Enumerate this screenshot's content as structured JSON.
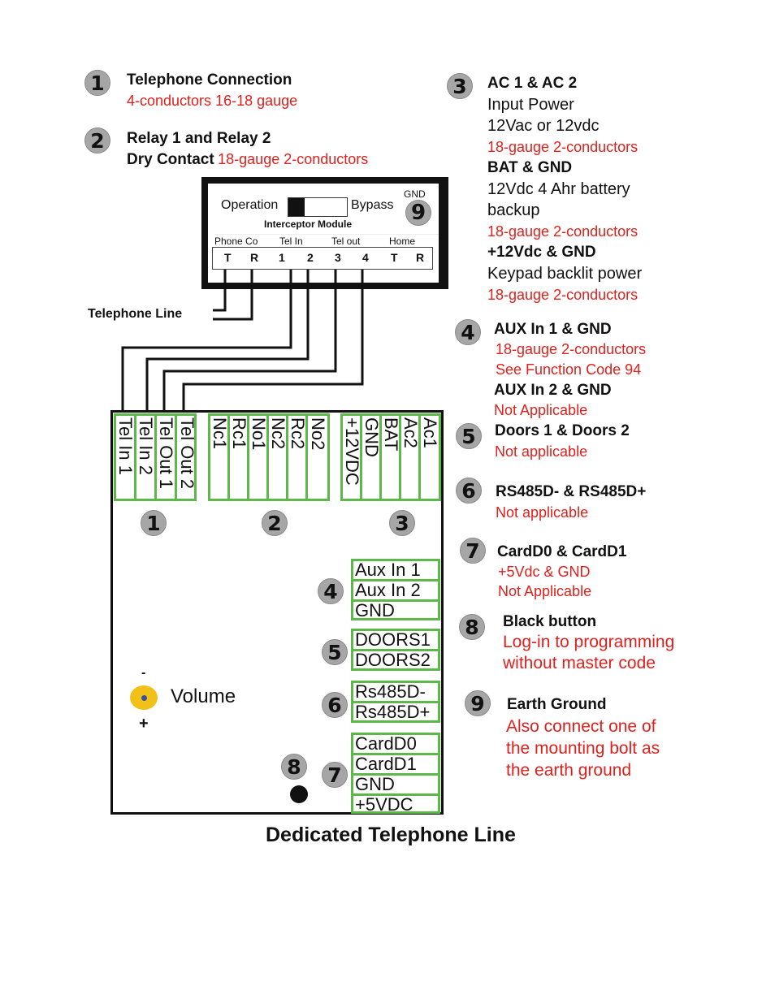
{
  "legend": {
    "item1": {
      "number": "1",
      "title": "Telephone Connection",
      "note": "4-conductors 16-18 gauge"
    },
    "item2": {
      "number": "2",
      "title_line1": "Relay 1 and Relay 2",
      "title_line2": "Dry Contact",
      "note": "18-gauge 2-conductors"
    },
    "item3": {
      "number": "3",
      "ac_title": "AC 1 & AC 2",
      "ac_line1": "Input Power",
      "ac_line2": "12Vac or 12vdc",
      "ac_note": "18-gauge 2-conductors",
      "bat_title": "BAT & GND",
      "bat_line1": "12Vdc 4 Ahr battery",
      "bat_line2": "backup",
      "bat_note": "18-gauge 2-conductors",
      "kp_title": "+12Vdc & GND",
      "kp_line1": "Keypad backlit power",
      "kp_note": "18-gauge 2-conductors"
    },
    "item4": {
      "number": "4",
      "title1": "AUX In 1 & GND",
      "note1a": "18-gauge 2-conductors",
      "note1b": "See Function Code 94",
      "title2": "AUX In 2 & GND",
      "note2": "Not Applicable"
    },
    "item5": {
      "number": "5",
      "title": "Doors 1 & Doors 2",
      "note": "Not applicable"
    },
    "item6": {
      "number": "6",
      "title": "RS485D- & RS485D+",
      "note": "Not applicable"
    },
    "item7": {
      "number": "7",
      "title": "CardD0 & CardD1",
      "note1": "+5Vdc & GND",
      "note2": "Not Applicable"
    },
    "item8": {
      "number": "8",
      "title": "Black button",
      "note1": "Log-in to programming",
      "note2": "without master code"
    },
    "item9": {
      "number": "9",
      "title": "Earth Ground",
      "note1": "Also connect one of",
      "note2": "the mounting bolt as",
      "note3": "the earth ground"
    }
  },
  "module": {
    "operation": "Operation",
    "bypass": "Bypass",
    "gnd": "GND",
    "badge": "9",
    "name": "Interceptor Module",
    "groups": [
      "Phone Co",
      "Tel In",
      "Tel out",
      "Home"
    ],
    "terminals": [
      "T",
      "R",
      "1",
      "2",
      "3",
      "4",
      "T",
      "R"
    ]
  },
  "telephone_line_label": "Telephone Line",
  "board": {
    "block1": [
      "Tel In 1",
      "Tel In 2",
      "Tel Out 1",
      "Tel Out 2"
    ],
    "block2": [
      "Nc1",
      "Rc1",
      "No1",
      "Nc2",
      "Rc2",
      "No2"
    ],
    "block3": [
      "+12VDC",
      "GND",
      "BAT",
      "Ac2",
      "Ac1"
    ],
    "block4": [
      "Aux In 1",
      "Aux In 2",
      "GND"
    ],
    "block5": [
      "DOORS1",
      "DOORS2"
    ],
    "block6": [
      "Rs485D-",
      "Rs485D+"
    ],
    "block7": [
      "CardD0",
      "CardD1",
      "GND",
      "+5VDC"
    ],
    "badges": [
      "1",
      "2",
      "3",
      "4",
      "5",
      "6",
      "7",
      "8"
    ],
    "volume_label": "Volume",
    "volume_minus": "-",
    "volume_plus": "+"
  },
  "caption": "Dedicated Telephone Line",
  "colors": {
    "note_red": "#e0201c",
    "terminal_green": "#5cb848",
    "badge_gray": "#a6a6a6",
    "knob_yellow": "#f2c118",
    "knob_dot": "#3a4fa0"
  }
}
